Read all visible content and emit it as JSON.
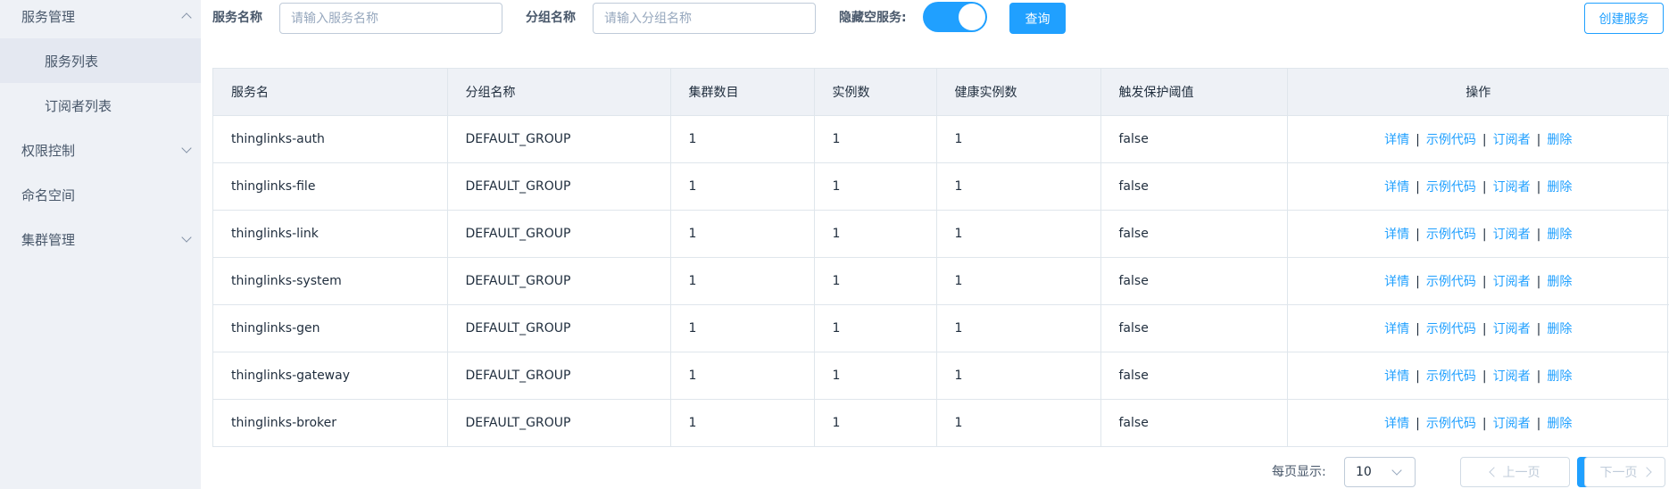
{
  "sidebar": {
    "items": [
      {
        "label": "服务管理"
      },
      {
        "label": "服务列表"
      },
      {
        "label": "订阅者列表"
      },
      {
        "label": "权限控制"
      },
      {
        "label": "命名空间"
      },
      {
        "label": "集群管理"
      }
    ]
  },
  "toolbar": {
    "service_name_label": "服务名称",
    "service_name_placeholder": "请输入服务名称",
    "group_name_label": "分组名称",
    "group_name_placeholder": "请输入分组名称",
    "hide_empty_label": "隐藏空服务:",
    "hide_empty_on": true,
    "query_label": "查询",
    "create_label": "创建服务"
  },
  "table": {
    "headers": [
      "服务名",
      "分组名称",
      "集群数目",
      "实例数",
      "健康实例数",
      "触发保护阈值",
      "操作"
    ],
    "rows": [
      [
        "thinglinks-auth",
        "DEFAULT_GROUP",
        "1",
        "1",
        "1",
        "false"
      ],
      [
        "thinglinks-file",
        "DEFAULT_GROUP",
        "1",
        "1",
        "1",
        "false"
      ],
      [
        "thinglinks-link",
        "DEFAULT_GROUP",
        "1",
        "1",
        "1",
        "false"
      ],
      [
        "thinglinks-system",
        "DEFAULT_GROUP",
        "1",
        "1",
        "1",
        "false"
      ],
      [
        "thinglinks-gen",
        "DEFAULT_GROUP",
        "1",
        "1",
        "1",
        "false"
      ],
      [
        "thinglinks-gateway",
        "DEFAULT_GROUP",
        "1",
        "1",
        "1",
        "false"
      ],
      [
        "thinglinks-broker",
        "DEFAULT_GROUP",
        "1",
        "1",
        "1",
        "false"
      ]
    ],
    "actions": [
      "详情",
      "示例代码",
      "订阅者",
      "删除"
    ],
    "separator": "|"
  },
  "pagination": {
    "per_page_label": "每页显示:",
    "page_size": "10",
    "prev_label": "上一页",
    "current_page": "1",
    "next_label": "下一页"
  },
  "colors": {
    "primary": "#20a0ff",
    "sidebar_bg": "#eef1f6",
    "header_bg": "#eef1f6"
  }
}
